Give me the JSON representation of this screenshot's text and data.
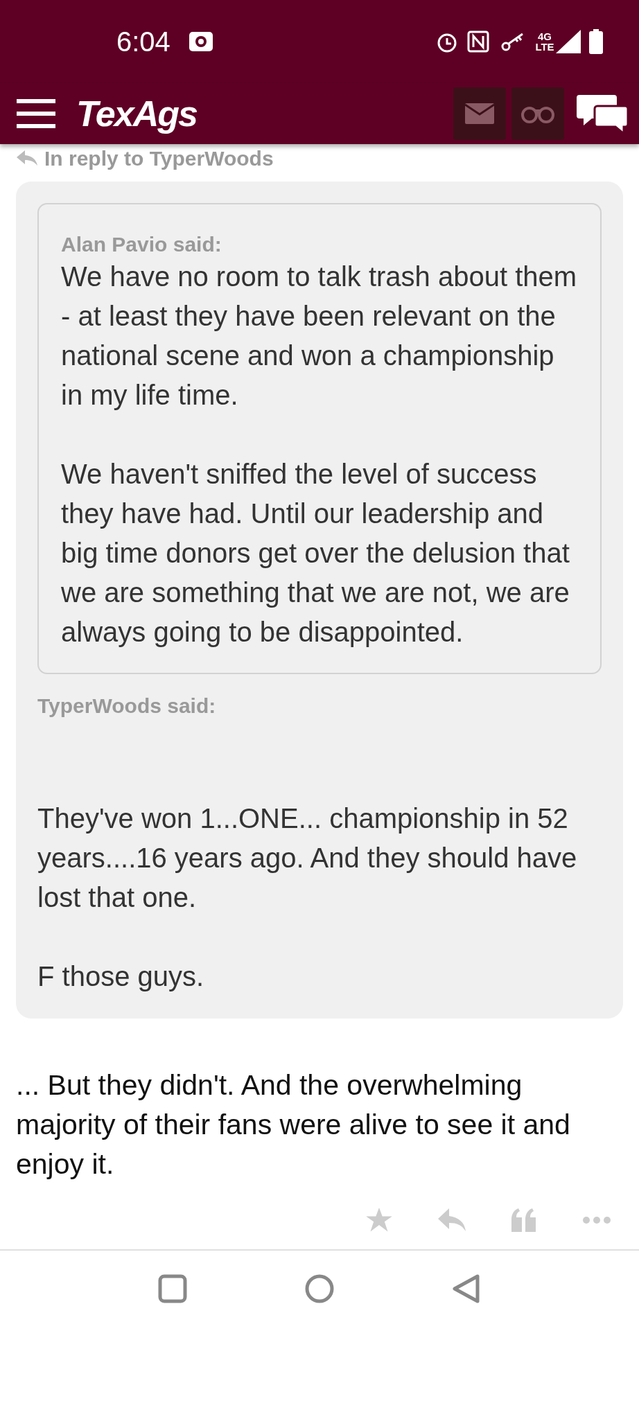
{
  "status_bar": {
    "time": "6:04",
    "network": "4G LTE"
  },
  "header": {
    "logo": "TexAgs"
  },
  "in_reply_to": "In reply to TyperWoods",
  "post": {
    "nested_quote": {
      "author": "Alan Pavio said:",
      "paragraphs": [
        "We have no room to talk trash about them - at least they have been relevant on the national scene and won a championship in my life time.",
        "We haven't sniffed the level of success they have had. Until our leadership and big time donors get over the delusion that we are something that we are not, we are always going to be disappointed."
      ]
    },
    "quote_author": "TyperWoods said:",
    "quote_paragraphs": [
      "They've won 1...ONE... championship in 52 years....16 years ago. And they should have lost that one.",
      "F those guys."
    ],
    "body": "... But they didn't. And the overwhelming majority of their fans were alive to see it and enjoy it."
  }
}
